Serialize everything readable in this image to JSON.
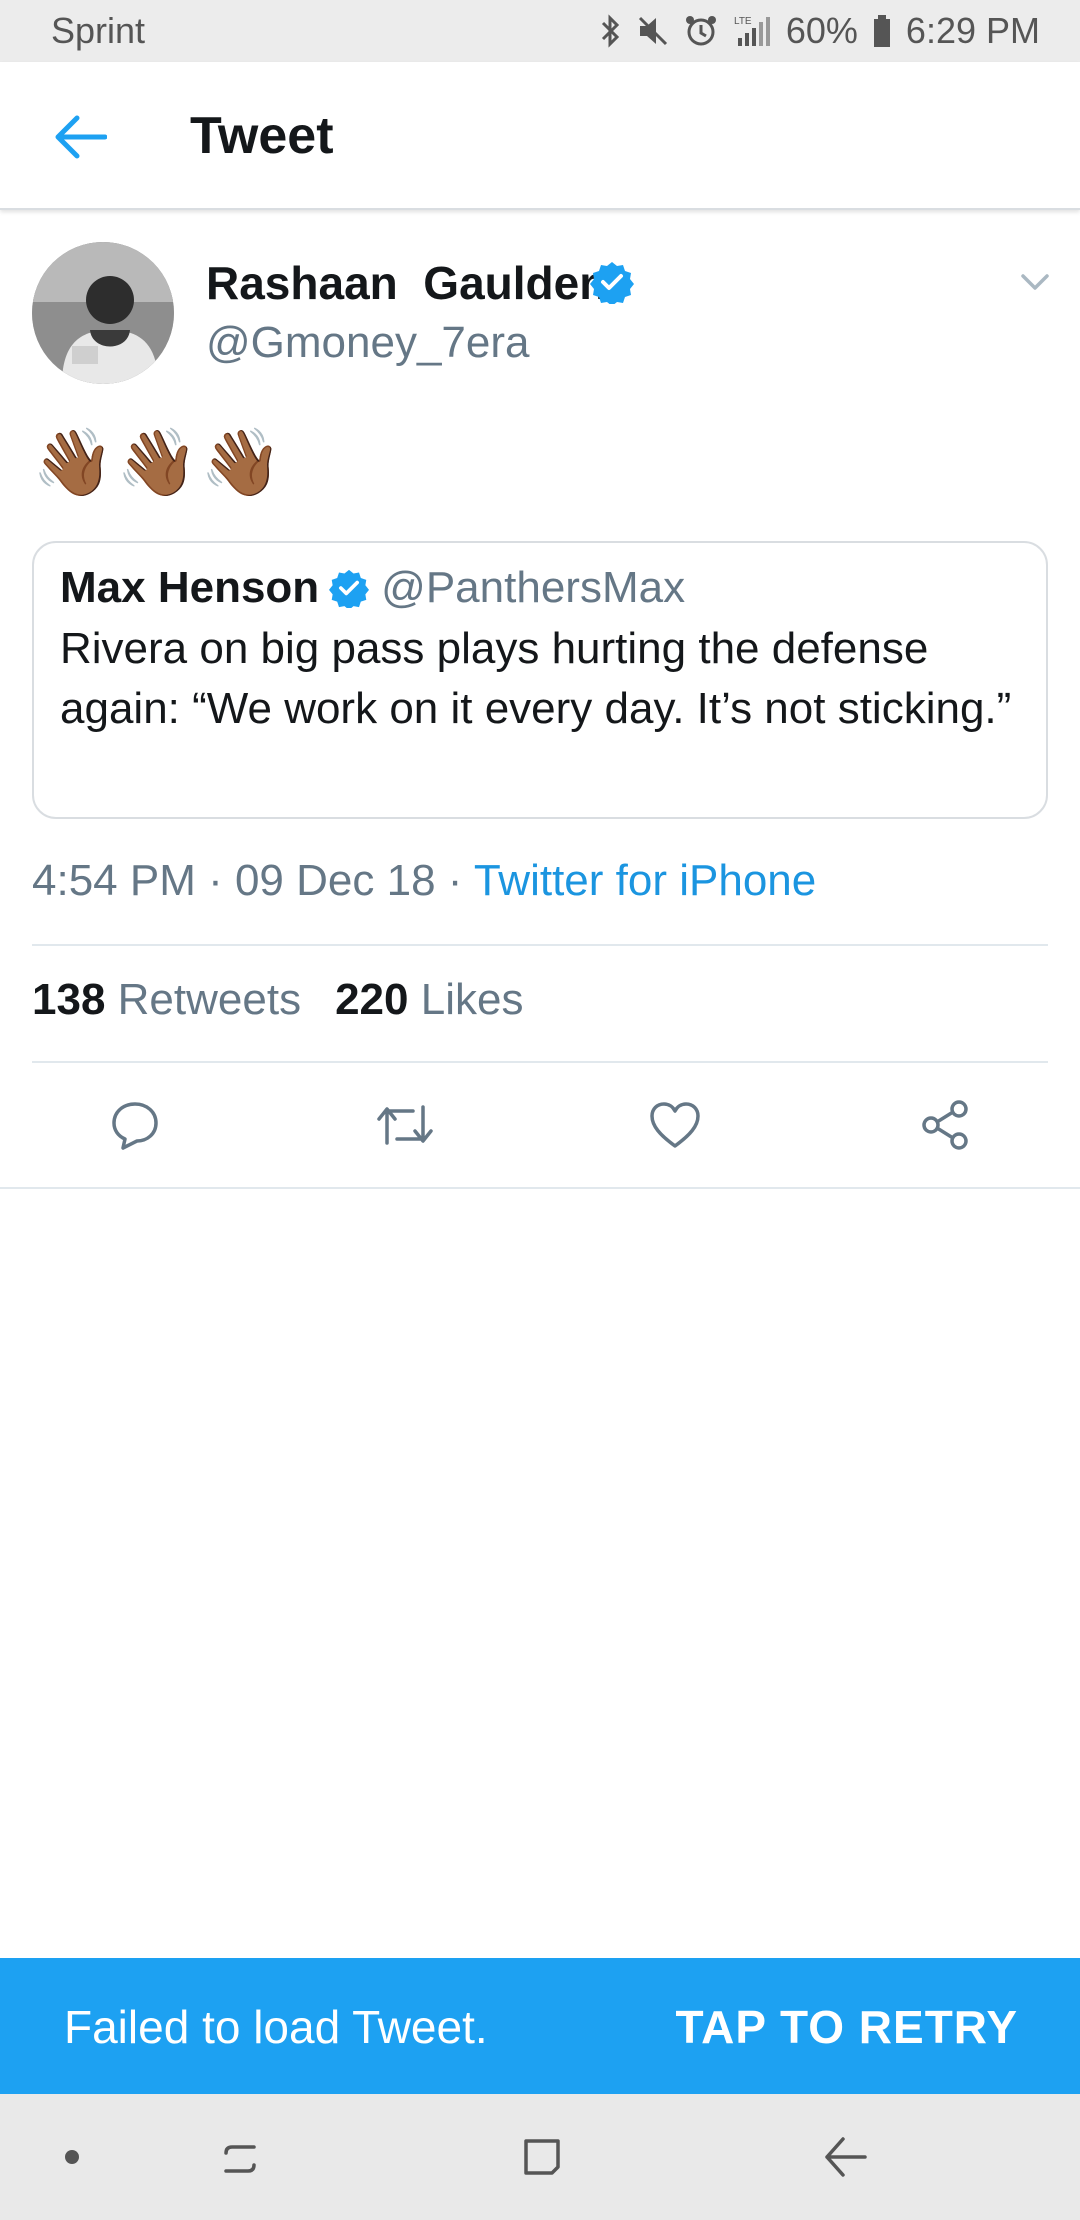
{
  "status_bar": {
    "carrier": "Sprint",
    "battery": "60%",
    "time": "6:29 PM",
    "icons": [
      "bluetooth-icon",
      "mute-icon",
      "alarm-icon",
      "lte-signal-icon",
      "battery-icon"
    ]
  },
  "header": {
    "title": "Tweet",
    "back_icon": "arrow-left-icon"
  },
  "tweet": {
    "author_name": "Rashaan  Gaulden",
    "author_handle": "@Gmoney_7era",
    "verified": true,
    "text": "👋🏾👋🏾👋🏾",
    "timestamp": "4:54 PM · 09 Dec 18 · ",
    "source": "Twitter for iPhone",
    "retweet_count": "138",
    "retweet_label": "Retweets",
    "like_count": "220",
    "like_label": "Likes"
  },
  "quoted_tweet": {
    "author_name": "Max Henson",
    "author_handle": "@PanthersMax",
    "verified": true,
    "text": "Rivera on big pass plays hurting the defense again: “We work on it every day. It’s not sticking.”"
  },
  "actions": [
    "reply-icon",
    "retweet-icon",
    "like-icon",
    "share-icon"
  ],
  "snackbar": {
    "message": "Failed to load Tweet.",
    "action": "TAP TO RETRY"
  },
  "colors": {
    "accent": "#1da1f2",
    "link": "#1b95e0",
    "secondary_text": "#657786",
    "primary_text": "#14171a"
  }
}
